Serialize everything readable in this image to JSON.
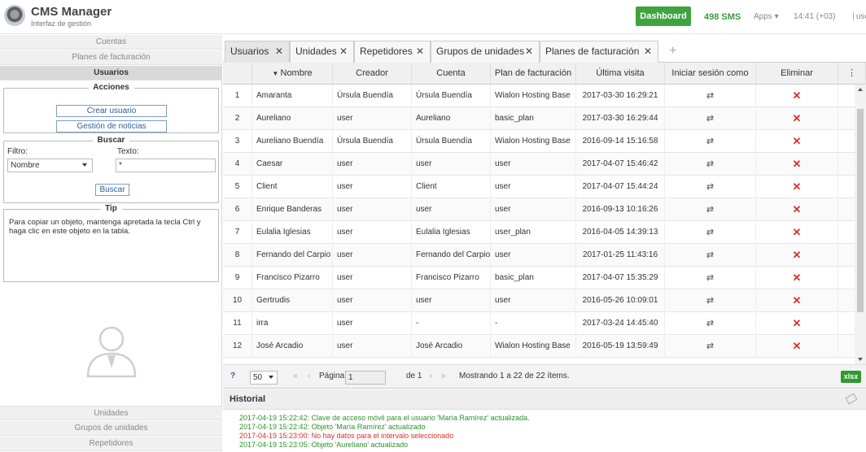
{
  "header": {
    "title": "CMS Manager",
    "subtitle": "Interfaz de gestión",
    "dashboard_label": "Dashboard",
    "sms_count": "498 SMS",
    "apps_label": "Apps ▾",
    "time": "14:41 (+03)",
    "user": "user"
  },
  "sidebar": {
    "top_tabs": [
      "Cuentas",
      "Planes de facturación",
      "Usuarios"
    ],
    "acciones": {
      "title": "Acciones",
      "create_user": "Crear usuario",
      "news": "Gestión de noticias"
    },
    "buscar": {
      "title": "Buscar",
      "filter_label": "Filtro:",
      "filter_value": "Nombre",
      "text_label": "Texto:",
      "text_value": "*",
      "search_button": "Buscar"
    },
    "tip": {
      "title": "Tip",
      "text": "Para copiar un objeto, mantenga apretada la tecla Ctrl y haga clic en este objeto en la tabla."
    },
    "bottom_tabs": [
      "Unidades",
      "Grupos de unidades",
      "Repetidores"
    ]
  },
  "tabs": [
    {
      "label": "Usuarios"
    },
    {
      "label": "Unidades"
    },
    {
      "label": "Repetidores"
    },
    {
      "label": "Grupos de unidades"
    },
    {
      "label": "Planes de facturación"
    }
  ],
  "table": {
    "columns": [
      "",
      "Nombre",
      "Creador",
      "Cuenta",
      "Plan de facturación",
      "Última visita",
      "Iniciar sesión como",
      "Eliminar",
      "⋮"
    ],
    "rows": [
      {
        "n": "1",
        "nombre": "Amaranta",
        "creador": "Úrsula Buendía",
        "cuenta": "Úrsula Buendía",
        "plan": "Wialon Hosting Base",
        "visita": "2017-03-30 16:29:21"
      },
      {
        "n": "2",
        "nombre": "Aureliano",
        "creador": "user",
        "cuenta": "Aureliano",
        "plan": "basic_plan",
        "visita": "2017-03-30 16:29:44"
      },
      {
        "n": "3",
        "nombre": "Aureliano Buendía",
        "creador": "Úrsula Buendía",
        "cuenta": "Úrsula Buendía",
        "plan": "Wialon Hosting Base",
        "visita": "2016-09-14 15:16:58"
      },
      {
        "n": "4",
        "nombre": "Caesar",
        "creador": "user",
        "cuenta": "user",
        "plan": "user",
        "visita": "2017-04-07 15:46:42"
      },
      {
        "n": "5",
        "nombre": "Client",
        "creador": "user",
        "cuenta": "Client",
        "plan": "user",
        "visita": "2017-04-07 15:44:24"
      },
      {
        "n": "6",
        "nombre": "Enrique Banderas",
        "creador": "user",
        "cuenta": "user",
        "plan": "user",
        "visita": "2016-09-13 10:16:26"
      },
      {
        "n": "7",
        "nombre": "Eulalia Iglesias",
        "creador": "user",
        "cuenta": "Eulalia Iglesias",
        "plan": "user_plan",
        "visita": "2016-04-05 14:39:13"
      },
      {
        "n": "8",
        "nombre": "Fernando del Carpio",
        "creador": "user",
        "cuenta": "Fernando del Carpio",
        "plan": "user",
        "visita": "2017-01-25 11:43:16"
      },
      {
        "n": "9",
        "nombre": "Francisco Pizarro",
        "creador": "user",
        "cuenta": "Francisco Pizarro",
        "plan": "basic_plan",
        "visita": "2017-04-07 15:35:29"
      },
      {
        "n": "10",
        "nombre": "Gertrudis",
        "creador": "user",
        "cuenta": "user",
        "plan": "user",
        "visita": "2016-05-26 10:09:01"
      },
      {
        "n": "11",
        "nombre": "irra",
        "creador": "user",
        "cuenta": "-",
        "plan": "-",
        "visita": "2017-03-24 14:45:40"
      },
      {
        "n": "12",
        "nombre": "José Arcadio",
        "creador": "user",
        "cuenta": "José Arcadio",
        "plan": "Wialon Hosting Base",
        "visita": "2016-05-19 13:59:49"
      }
    ]
  },
  "pager": {
    "help": "?",
    "per_page": "50",
    "first": "«",
    "prev": "‹",
    "page_label": "Página",
    "page_value": "1",
    "of": "de 1",
    "next": "›",
    "last": "»",
    "summary": "Mostrando 1 a 22 de 22 ítems.",
    "export": "xlsx"
  },
  "history": {
    "title": "Historial",
    "entries": [
      {
        "text": "2017-04-19 15:22:42: Clave de acceso móvil para el usuario 'María Ramírez' actualizada.",
        "status": "ok"
      },
      {
        "text": "2017-04-19 15:22:42: Objeto 'María Ramírez' actualizado",
        "status": "ok"
      },
      {
        "text": "2017-04-19 15:23:00: No hay datos para el intervalo seleccionado",
        "status": "error"
      },
      {
        "text": "2017-04-19 15:23:05: Objeto 'Aureliano' actualizado",
        "status": "ok"
      }
    ]
  },
  "colors": {
    "accent_green": "#3fa43f",
    "delete_red": "#d9302c",
    "link_blue": "#2e5e9a"
  },
  "icons": [
    "app-logo-icon",
    "sort-down-icon",
    "login-as-icon",
    "delete-icon",
    "add-tab-icon",
    "eraser-icon",
    "avatar-placeholder-icon"
  ]
}
